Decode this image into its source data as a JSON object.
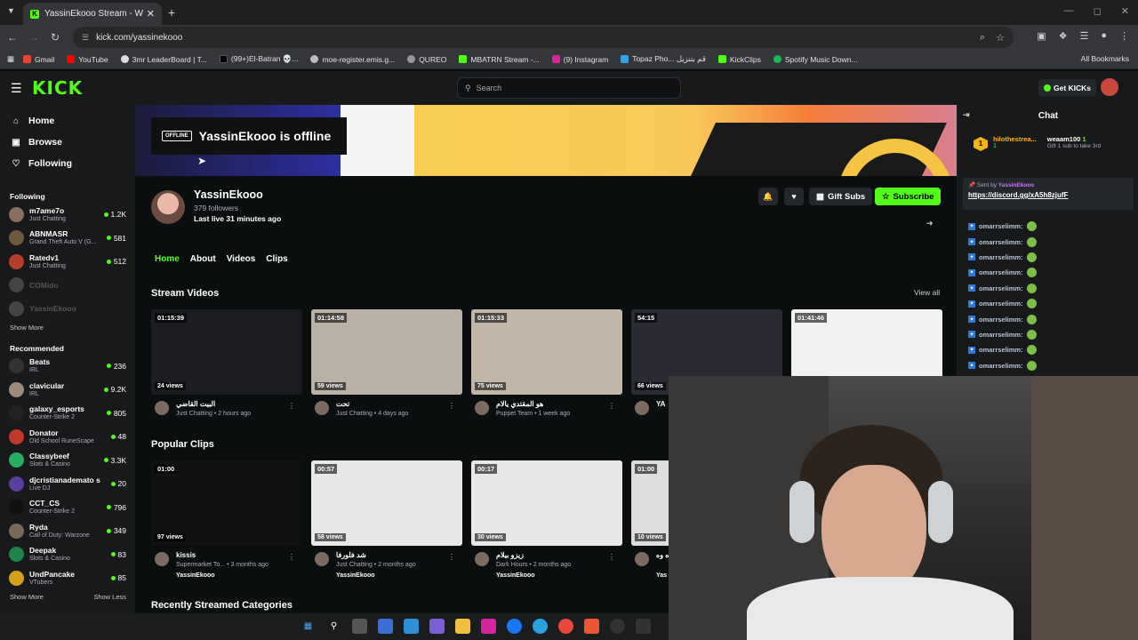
{
  "browser": {
    "tab_title": "YassinEkooo Stream - Watch Li",
    "url": "kick.com/yassinekooo",
    "bookmarks": [
      "Gmail",
      "YouTube",
      "3mr LeaderBoard | T...",
      "(99+)El-Batran 💀...",
      "moe-register.emis.g...",
      "QUREO",
      "MBATRN Stream -...",
      "(9) Instagram",
      "Topaz Pho... قم بتنزيل",
      "KickClips",
      "Spotify Music Down..."
    ],
    "all_bookmarks": "All Bookmarks"
  },
  "kick": {
    "logo": "KICK",
    "search_placeholder": "Search",
    "get_kicks": "Get KICKs"
  },
  "sidebar": {
    "nav": [
      {
        "label": "Home",
        "icon": "home-icon"
      },
      {
        "label": "Browse",
        "icon": "browse-icon"
      },
      {
        "label": "Following",
        "icon": "heart-icon"
      }
    ],
    "following_title": "Following",
    "following": [
      {
        "name": "m7ame7o",
        "cat": "Just Chatting",
        "count": "1.2K",
        "color": "#8a6f60"
      },
      {
        "name": "ABNMASR",
        "cat": "Grand Theft Auto V (G...",
        "count": "581",
        "color": "#6d5a3c"
      },
      {
        "name": "Ratedv1",
        "cat": "Just Chatting",
        "count": "512",
        "color": "#b53d2a"
      },
      {
        "name": "COMido",
        "cat": "",
        "count": "",
        "color": "#444"
      },
      {
        "name": "YassinEkooo",
        "cat": "",
        "count": "",
        "color": "#444"
      }
    ],
    "show_more": "Show More",
    "recommended_title": "Recommended",
    "recommended": [
      {
        "name": "Beats",
        "cat": "IRL",
        "count": "236",
        "color": "#333"
      },
      {
        "name": "clavicular",
        "cat": "IRL",
        "count": "9.2K",
        "color": "#9d8a7a"
      },
      {
        "name": "galaxy_esports",
        "cat": "Counter-Strike 2",
        "count": "805",
        "color": "#222"
      },
      {
        "name": "Donator",
        "cat": "Old School RuneScape",
        "count": "48",
        "color": "#c0392b"
      },
      {
        "name": "Classybeef",
        "cat": "Slots & Casino",
        "count": "3.3K",
        "color": "#27ae60"
      },
      {
        "name": "djcristianademato s",
        "cat": "Live DJ",
        "count": "20",
        "color": "#5b3fa0"
      },
      {
        "name": "CCT_CS",
        "cat": "Counter-Strike 2",
        "count": "796",
        "color": "#111"
      },
      {
        "name": "Ryda",
        "cat": "Call of Duty: Warzone",
        "count": "349",
        "color": "#7a6a5a"
      },
      {
        "name": "Deepak",
        "cat": "Slots & Casino",
        "count": "83",
        "color": "#1e8449"
      },
      {
        "name": "UndPancake",
        "cat": "VTubers",
        "count": "85",
        "color": "#d4a017"
      }
    ],
    "show_more2": "Show More",
    "show_less": "Show Less"
  },
  "channel": {
    "offline_badge": "OFFLINE",
    "offline_text": "YassinEkooo is offline",
    "name": "YassinEkooo",
    "followers": "379 followers",
    "last_live": "Last live 31 minutes ago",
    "gift_subs": "Gift Subs",
    "subscribe": "Subscribe",
    "tabs": [
      "Home",
      "About",
      "Videos",
      "Clips"
    ]
  },
  "stream_videos": {
    "title": "Stream Videos",
    "view_all": "View all",
    "items": [
      {
        "dur": "01:15:39",
        "views": "24 views",
        "title": "البيت القاضي",
        "sub": "Just Chatting • 2 hours ago",
        "bg": "#1c1d22"
      },
      {
        "dur": "01:14:58",
        "views": "59 views",
        "title": "تحت",
        "sub": "Just Chatting • 4 days ago",
        "bg": "#b9b0a6"
      },
      {
        "dur": "01:15:33",
        "views": "75 views",
        "title": "هو المقتدي يالام",
        "sub": "Puppet Team • 1 week ago",
        "bg": "#c2b6a8"
      },
      {
        "dur": "54:15",
        "views": "66 views",
        "title": "YA",
        "sub": "",
        "bg": "#2a2a33"
      },
      {
        "dur": "01:41:46",
        "views": "",
        "title": "",
        "sub": "",
        "bg": "#f2f2f2"
      }
    ]
  },
  "popular_clips": {
    "title": "Popular Clips",
    "items": [
      {
        "dur": "01:00",
        "views": "97 views",
        "title": "kissis",
        "sub": "Supermarket To... • 3 months ago",
        "user": "YassinEkooo",
        "bg": "#111"
      },
      {
        "dur": "00:57",
        "views": "58 views",
        "title": "شد فلورفا",
        "sub": "Just Chatting • 2 months ago",
        "user": "YassinEkooo",
        "bg": "#e8e8ea"
      },
      {
        "dur": "00:17",
        "views": "30 views",
        "title": "زيزو بيلام",
        "sub": "Dark Hours • 2 months ago",
        "user": "YassinEkooo",
        "bg": "#e8e8ea"
      },
      {
        "dur": "01:00",
        "views": "10 views",
        "title": "واه وه",
        "sub": "",
        "user": "Yas",
        "bg": "#ddd"
      }
    ]
  },
  "recent_categories": "Recently Streamed Categories",
  "chat": {
    "title": "Chat",
    "top_user": "hilothestrea...",
    "top_count": "1",
    "gifter": "weaam100",
    "gifter_count": "1",
    "gift_note": "Gift 1 sub to take 3rd",
    "pinned_by": "Sent by",
    "pinned_user": "YassinEkooo",
    "pinned_link": "https://discord.gg/xA5h8zjufF",
    "messages": [
      "omarrselimm:",
      "omarrselimm:",
      "omarrselimm:",
      "omarrselimm:",
      "omarrselimm:",
      "omarrselimm:",
      "omarrselimm:",
      "omarrselimm:",
      "omarrselimm:",
      "omarrselimm:"
    ]
  }
}
